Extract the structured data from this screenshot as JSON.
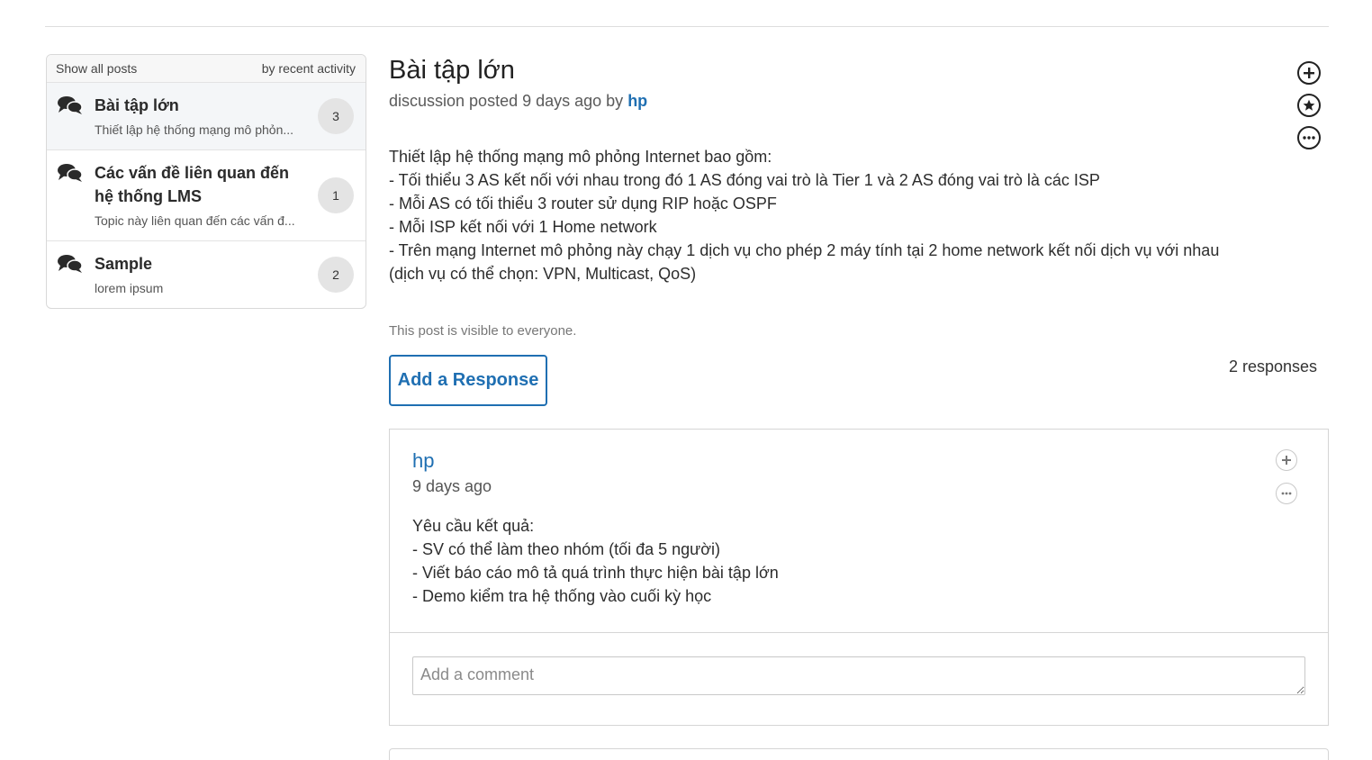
{
  "sidebar": {
    "filter_label": "Show all posts",
    "sort_label": "by recent activity",
    "posts": [
      {
        "title": "Bài tập lớn",
        "snippet": "Thiết lập hệ thống mạng mô phỏn...",
        "count": "3"
      },
      {
        "title": "Các vấn đề liên quan đến hệ thống LMS",
        "snippet": "Topic này liên quan đến các vấn đ...",
        "count": "1"
      },
      {
        "title": "Sample",
        "snippet": "lorem ipsum",
        "count": "2"
      }
    ]
  },
  "thread": {
    "title": "Bài tập lớn",
    "meta_prefix": "discussion posted 9 days ago by",
    "author": "hp",
    "body_lines": [
      "Thiết lập hệ thống mạng mô phỏng Internet bao gồm:",
      "- Tối thiểu 3 AS kết nối với nhau trong đó 1 AS đóng vai trò là Tier 1 và 2 AS đóng vai trò là các ISP",
      "- Mỗi AS có tối thiểu 3 router sử dụng RIP hoặc OSPF",
      "- Mỗi ISP kết nối với 1 Home network",
      "- Trên mạng Internet mô phỏng này chạy 1 dịch vụ cho phép 2 máy tính tại 2 home network kết nối dịch vụ với nhau",
      "(dịch vụ có thể chọn: VPN, Multicast, QoS)"
    ],
    "visibility": "This post is visible to everyone.",
    "add_response_label": "Add a Response",
    "responses_count": "2 responses"
  },
  "response": {
    "author": "hp",
    "time": "9 days ago",
    "body_lines": [
      "Yêu cầu kết quả:",
      "- SV có thể làm theo nhóm (tối đa 5 người)",
      "- Viết báo cáo mô tả quá trình thực hiện bài tập lớn",
      "- Demo kiểm tra hệ thống vào cuối kỳ học"
    ],
    "comment_placeholder": "Add a comment"
  },
  "icons": {
    "post_icon": "chat-bubbles-icon",
    "follow": "plus-icon",
    "star": "star-icon",
    "more": "more-icon"
  }
}
